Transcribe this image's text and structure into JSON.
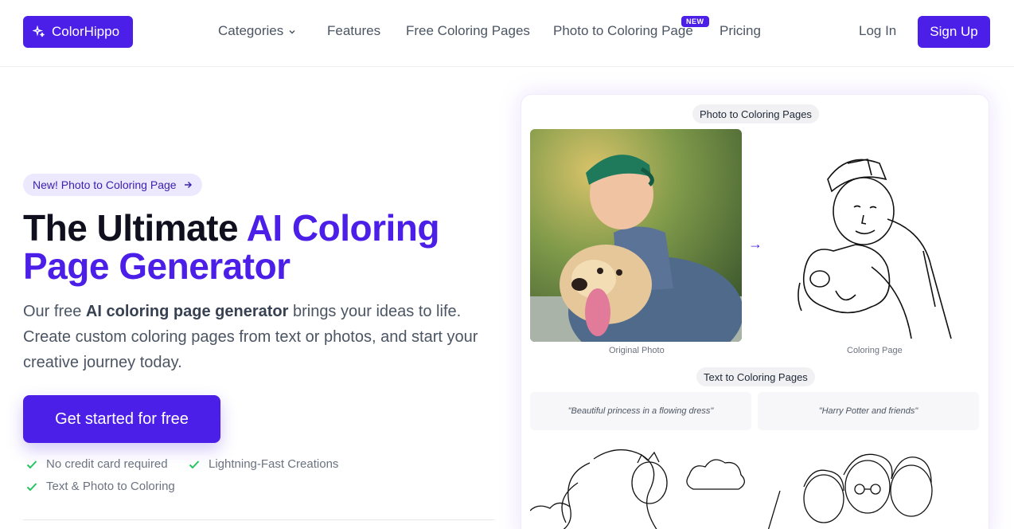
{
  "brand": {
    "name": "ColorHippo",
    "accent": "#4b1fe8"
  },
  "nav": {
    "items": [
      {
        "label": "Categories",
        "has_dropdown": true
      },
      {
        "label": "Features"
      },
      {
        "label": "Free Coloring Pages"
      },
      {
        "label": "Photo to Coloring Page",
        "badge": "NEW"
      },
      {
        "label": "Pricing"
      }
    ],
    "login": "Log In",
    "signup": "Sign Up"
  },
  "hero": {
    "pill": "New! Photo to Coloring Page",
    "title_plain": "The Ultimate ",
    "title_accent": "AI Coloring Page Generator",
    "desc_pre": "Our free ",
    "desc_bold": "AI coloring page generator",
    "desc_post": " brings your ideas to life. Create custom coloring pages from text or photos, and start your creative journey today.",
    "cta": "Get started for free",
    "checks": [
      "No credit card required",
      "Lightning-Fast Creations",
      "Text & Photo to Coloring"
    ]
  },
  "showcase": {
    "photo_section": "Photo to Coloring Pages",
    "original_caption": "Original Photo",
    "coloring_caption": "Coloring Page",
    "text_section": "Text to Coloring Pages",
    "prompts": [
      "\"Beautiful princess in a flowing dress\"",
      "\"Harry Potter and friends\""
    ]
  }
}
